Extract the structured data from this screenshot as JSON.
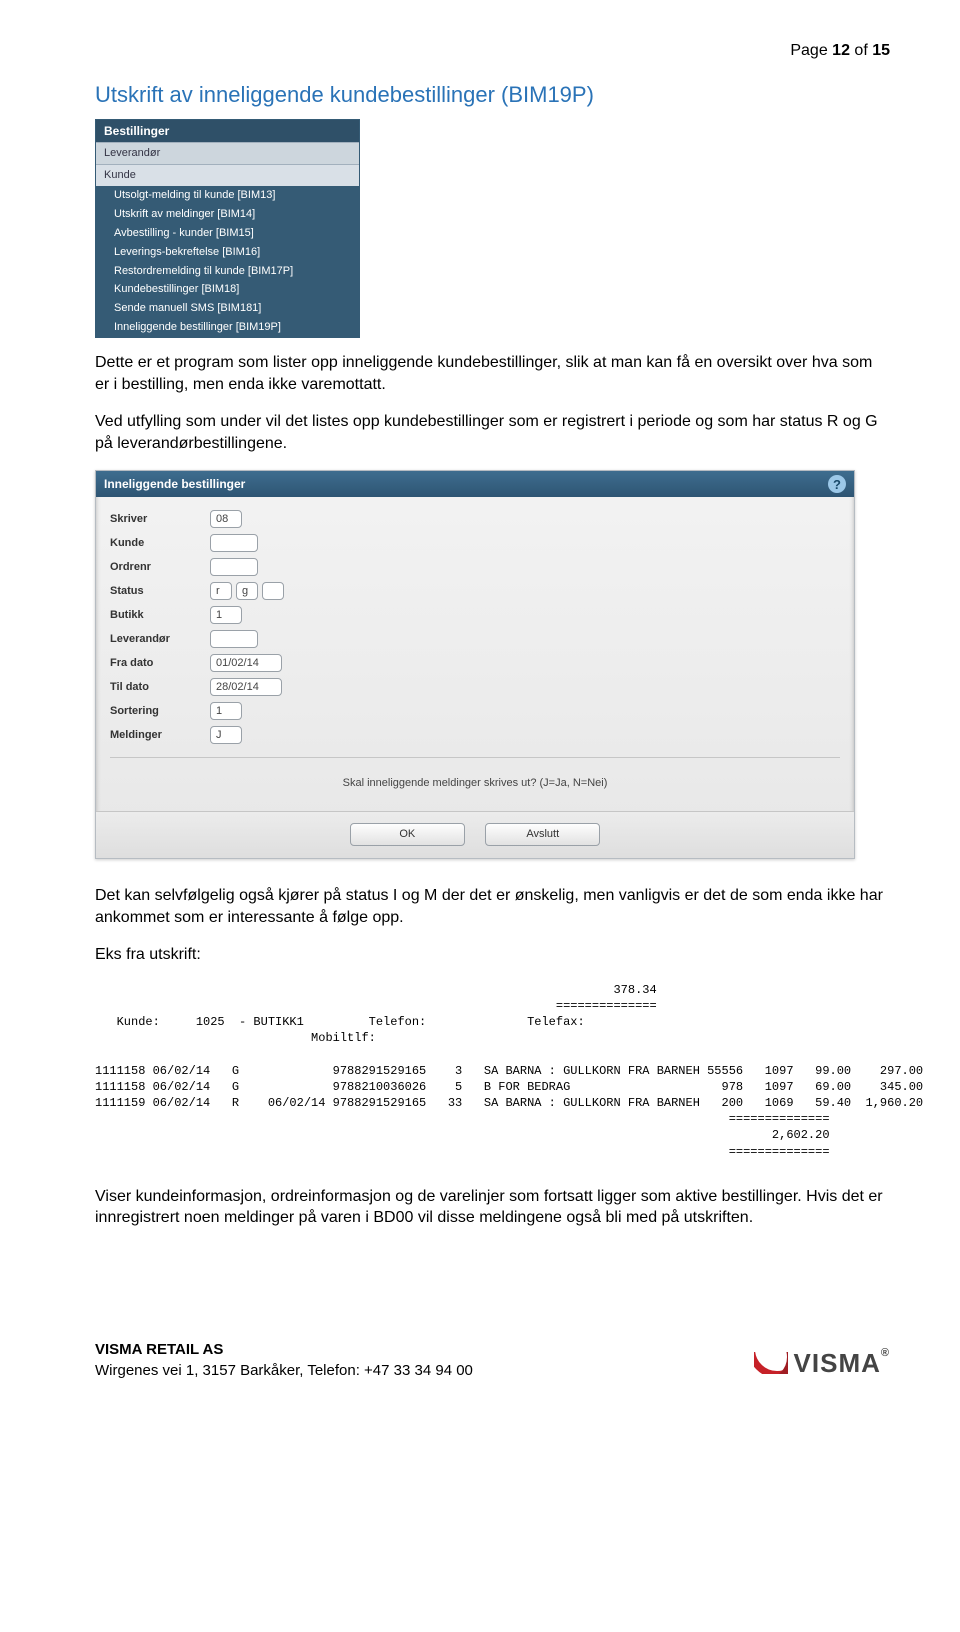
{
  "page_indicator": {
    "prefix": "Page ",
    "current": "12",
    "of": " of ",
    "total": "15"
  },
  "section_title": "Utskrift av inneliggende kundebestillinger (BIM19P)",
  "menu": {
    "header": "Bestillinger",
    "section1": "Leverandør",
    "section2": "Kunde",
    "items": [
      "Utsolgt-melding til kunde [BIM13]",
      "Utskrift av meldinger [BIM14]",
      "Avbestilling - kunder [BIM15]",
      "Leverings-bekreftelse [BIM16]",
      "Restordremelding til kunde [BIM17P]",
      "Kundebestillinger [BIM18]",
      "Sende manuell SMS [BIM181]",
      "Inneliggende bestillinger [BIM19P]"
    ]
  },
  "para1": "Dette er et program som lister opp inneliggende kundebestillinger, slik at man kan få en oversikt over hva som er i bestilling, men enda ikke varemottatt.",
  "para2": "Ved utfylling som under vil det listes opp kundebestillinger som er registrert i periode og som har status R og G på leverandørbestillingene.",
  "dialog": {
    "title": "Inneliggende bestillinger",
    "fields": {
      "skriver": {
        "label": "Skriver",
        "value": "08"
      },
      "kunde": {
        "label": "Kunde",
        "value": ""
      },
      "ordrenr": {
        "label": "Ordrenr",
        "value": ""
      },
      "status": {
        "label": "Status",
        "v1": "r",
        "v2": "g",
        "v3": ""
      },
      "butikk": {
        "label": "Butikk",
        "value": "1"
      },
      "leverandor": {
        "label": "Leverandør",
        "value": ""
      },
      "fra_dato": {
        "label": "Fra dato",
        "value": "01/02/14"
      },
      "til_dato": {
        "label": "Til dato",
        "value": "28/02/14"
      },
      "sortering": {
        "label": "Sortering",
        "value": "1"
      },
      "meldinger": {
        "label": "Meldinger",
        "value": "J"
      }
    },
    "prompt": "Skal inneliggende meldinger skrives ut? (J=Ja, N=Nei)",
    "buttons": {
      "ok": "OK",
      "avslutt": "Avslutt"
    }
  },
  "para3": "Det kan selvfølgelig også kjører på status I og M der det er ønskelig, men vanligvis er det de som enda ikke har ankommet som er interessante å følge opp.",
  "eks_label": "Eks fra utskrift:",
  "chart_data": {
    "type": "table",
    "top_total": "378.34",
    "header": {
      "kunde_label": "Kunde:",
      "kunde_value": "1025  - BUTIKK1",
      "telefon_label": "Telefon:",
      "telefax_label": "Telefax:",
      "mobil_label": "Mobiltlf:"
    },
    "rows": [
      {
        "ordre": "1111158",
        "dato": "06/02/14",
        "status": "G",
        "lev_dato": "",
        "ean": "9788291529165",
        "ant": "3",
        "tittel": "SA BARNA : GULLKORN FRA BARNEH",
        "lev": "55556",
        "kode": "1097",
        "pris": "99.00",
        "sum": "297.00"
      },
      {
        "ordre": "1111158",
        "dato": "06/02/14",
        "status": "G",
        "lev_dato": "",
        "ean": "9788210036026",
        "ant": "5",
        "tittel": "B FOR BEDRAG",
        "lev": "978",
        "kode": "1097",
        "pris": "69.00",
        "sum": "345.00"
      },
      {
        "ordre": "1111159",
        "dato": "06/02/14",
        "status": "R",
        "lev_dato": "06/02/14",
        "ean": "9788291529165",
        "ant": "33",
        "tittel": "SA BARNA : GULLKORN FRA BARNEH",
        "lev": "200",
        "kode": "1069",
        "pris": "59.40",
        "sum": "1,960.20"
      }
    ],
    "grand_total": "2,602.20"
  },
  "para4": "Viser kundeinformasjon, ordreinformasjon og de varelinjer som fortsatt ligger som aktive bestillinger. Hvis det er innregistrert noen meldinger på varen i BD00 vil disse meldingene også bli med på utskriften.",
  "footer": {
    "company": "VISMA RETAIL AS",
    "address": "Wirgenes vei 1, 3157 Barkåker, Telefon: +47 33 34 94 00",
    "logo_word": "VISMA"
  }
}
